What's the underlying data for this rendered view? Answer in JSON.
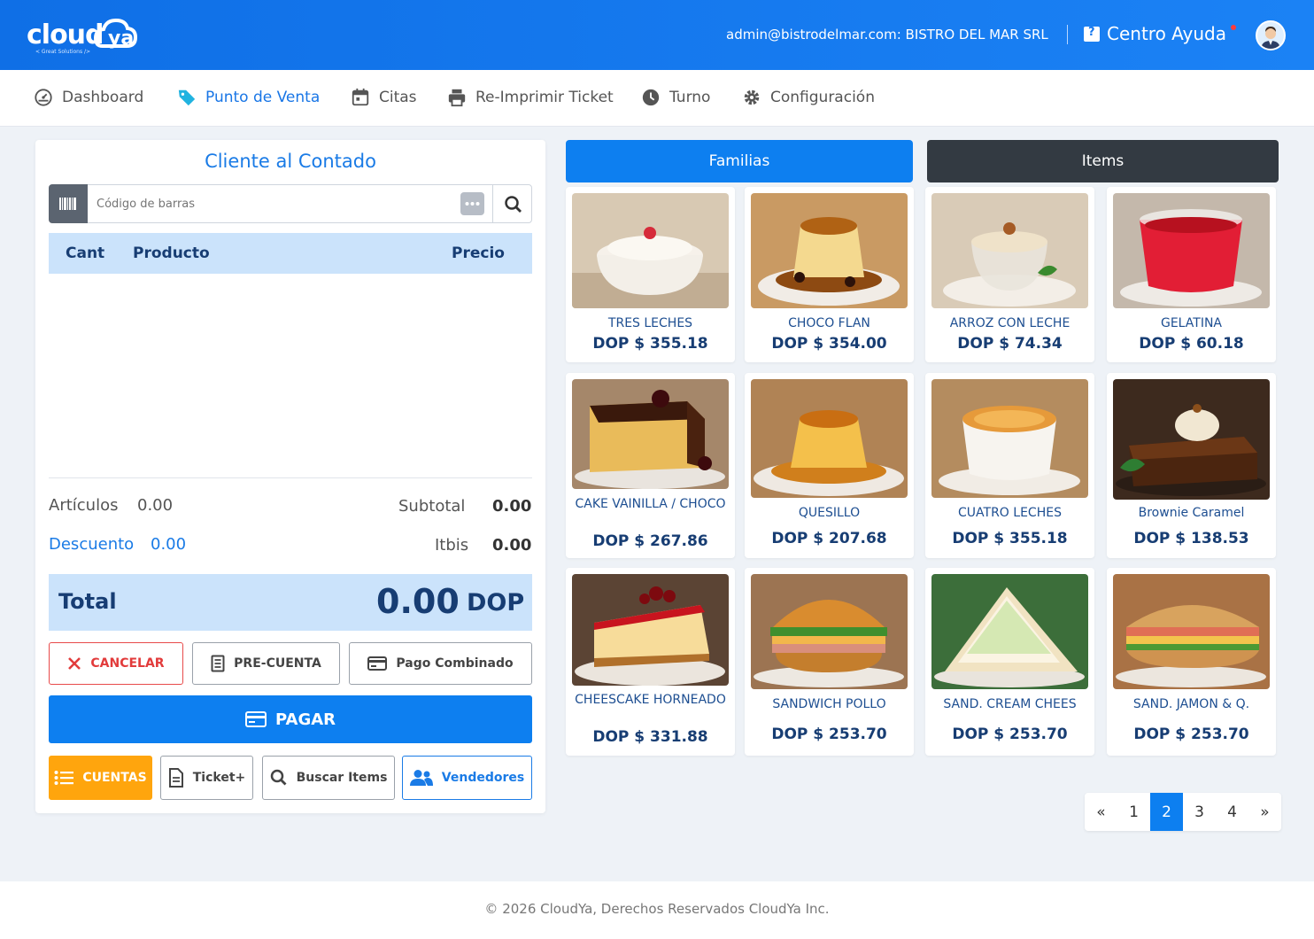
{
  "header": {
    "logo_text": "cloud ya",
    "logo_tagline": "< Great Solutions />",
    "account": "admin@bistrodelmar.com:  BISTRO DEL MAR SRL",
    "help_label": "Centro Ayuda",
    "brand_color": "#1477EE"
  },
  "nav": {
    "items": [
      {
        "label": "Dashboard",
        "icon": "dashboard-icon"
      },
      {
        "label": "Punto de Venta",
        "icon": "tag-icon"
      },
      {
        "label": "Citas",
        "icon": "calendar-icon"
      },
      {
        "label": "Re-Imprimir Ticket",
        "icon": "printer-icon"
      },
      {
        "label": "Turno",
        "icon": "clock-icon"
      },
      {
        "label": "Configuración",
        "icon": "gear-icon"
      }
    ],
    "active": "Punto de Venta"
  },
  "order": {
    "customer": "Cliente al Contado",
    "barcode_placeholder": "Código de barras",
    "columns": {
      "qty": "Cant",
      "product": "Producto",
      "price": "Precio"
    },
    "articulos_label": "Artículos",
    "articulos_value": "0.00",
    "subtotal_label": "Subtotal",
    "subtotal_value": "0.00",
    "descuento_label": "Descuento",
    "descuento_value": "0.00",
    "itbis_label": "Itbis",
    "itbis_value": "0.00",
    "total_label": "Total",
    "total_value": "0.00",
    "currency": "DOP"
  },
  "actions": {
    "cancel": "CANCELAR",
    "precuenta": "PRE-CUENTA",
    "pago_combinado": "Pago Combinado",
    "pagar": "PAGAR",
    "cuentas": "CUENTAS",
    "ticket": "Ticket+",
    "buscar": "Buscar Items",
    "vendedores": "Vendedores"
  },
  "tabs": {
    "familias": "Familias",
    "items": "Items"
  },
  "products": [
    {
      "name": "TRES LECHES",
      "price": "DOP $ 355.18"
    },
    {
      "name": "CHOCO FLAN",
      "price": "DOP $ 354.00"
    },
    {
      "name": "ARROZ CON LECHE",
      "price": "DOP $ 74.34"
    },
    {
      "name": "GELATINA",
      "price": "DOP $ 60.18"
    },
    {
      "name": "CAKE VAINILLA / CHOCO",
      "price": "DOP $ 267.86"
    },
    {
      "name": "QUESILLO",
      "price": "DOP $ 207.68"
    },
    {
      "name": "CUATRO LECHES",
      "price": "DOP $ 355.18"
    },
    {
      "name": "Brownie Caramel",
      "price": "DOP $ 138.53"
    },
    {
      "name": "CHEESCAKE HORNEADO",
      "price": "DOP $ 331.88"
    },
    {
      "name": "SANDWICH POLLO",
      "price": "DOP $ 253.70"
    },
    {
      "name": "SAND. CREAM CHEES",
      "price": "DOP $ 253.70"
    },
    {
      "name": "SAND. JAMON & Q.",
      "price": "DOP $ 253.70"
    }
  ],
  "pagination": {
    "prev": "«",
    "pages": [
      "1",
      "2",
      "3",
      "4"
    ],
    "current": "2",
    "next": "»"
  },
  "footer": "© 2026 CloudYa, Derechos Reservados CloudYa Inc."
}
